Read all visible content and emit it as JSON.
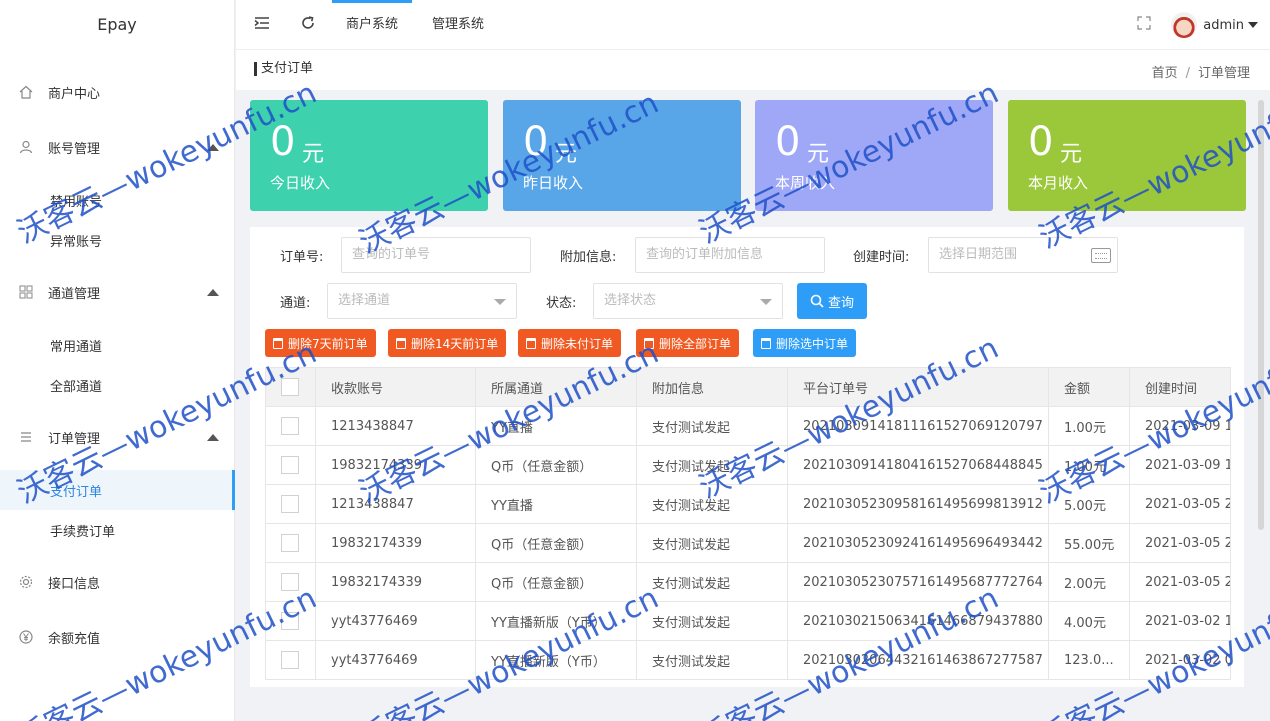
{
  "app": {
    "brand": "Epay"
  },
  "sidebar": {
    "items": [
      {
        "label": "商户中心",
        "icon": "home-icon"
      },
      {
        "label": "账号管理",
        "icon": "user-icon",
        "sub": [
          "禁用账号",
          "异常账号"
        ]
      },
      {
        "label": "通道管理",
        "icon": "apps-icon",
        "sub": [
          "常用通道",
          "全部通道"
        ]
      },
      {
        "label": "订单管理",
        "icon": "list-icon",
        "sub": [
          "支付订单",
          "手续费订单"
        ],
        "active_sub": "支付订单"
      },
      {
        "label": "接口信息",
        "icon": "gear-icon"
      },
      {
        "label": "余额充值",
        "icon": "yen-icon"
      }
    ]
  },
  "header": {
    "tabs": [
      "商户系统",
      "管理系统"
    ],
    "user": "admin"
  },
  "breadcrumb": {
    "title": "支付订单",
    "path": [
      "首页",
      "订单管理"
    ],
    "separator": "/"
  },
  "stats": [
    {
      "value": "0",
      "unit": "元",
      "label": "今日收入",
      "color": "#3ed1ae"
    },
    {
      "value": "0",
      "unit": "元",
      "label": "昨日收入",
      "color": "#58a6e8"
    },
    {
      "value": "0",
      "unit": "元",
      "label": "本周收入",
      "color": "#9fa8f7"
    },
    {
      "value": "0",
      "unit": "元",
      "label": "本月收入",
      "color": "#9ac83a"
    }
  ],
  "filters": {
    "order_no": {
      "label": "订单号:",
      "placeholder": "查询的订单号"
    },
    "extra": {
      "label": "附加信息:",
      "placeholder": "查询的订单附加信息"
    },
    "created": {
      "label": "创建时间:",
      "placeholder": "选择日期范围"
    },
    "channel": {
      "label": "通道:",
      "placeholder": "选择通道"
    },
    "status": {
      "label": "状态:",
      "placeholder": "选择状态"
    },
    "search_label": "查询"
  },
  "actions": {
    "del7": "删除7天前订单",
    "del14": "删除14天前订单",
    "delunpaid": "删除未付订单",
    "delall": "删除全部订单",
    "delsel": "删除选中订单"
  },
  "table": {
    "headers": [
      "收款账号",
      "所属通道",
      "附加信息",
      "平台订单号",
      "金额",
      "创建时间"
    ],
    "rows": [
      [
        "1213438847",
        "YY直播",
        "支付测试发起",
        "20210309141811161527069120797",
        "1.00元",
        "2021-03-09 1"
      ],
      [
        "19832174339",
        "Q币（任意金额）",
        "支付测试发起",
        "20210309141804161527068448845",
        "1.00元",
        "2021-03-09 1"
      ],
      [
        "1213438847",
        "YY直播",
        "支付测试发起",
        "20210305230958161495699813912",
        "5.00元",
        "2021-03-05 2"
      ],
      [
        "19832174339",
        "Q币（任意金额）",
        "支付测试发起",
        "20210305230924161495696493442",
        "55.00元",
        "2021-03-05 2"
      ],
      [
        "19832174339",
        "Q币（任意金额）",
        "支付测试发起",
        "20210305230757161495687772764",
        "2.00元",
        "2021-03-05 2"
      ],
      [
        "yyt43776469",
        "YY直播新版（Y币）",
        "支付测试发起",
        "20210302150634161466879437880",
        "4.00元",
        "2021-03-02 1"
      ],
      [
        "yyt43776469",
        "YY直播新版（Y币）",
        "支付测试发起",
        "20210302064432161463867277587",
        "123.0...",
        "2021-03-02 0"
      ]
    ]
  },
  "watermark": "沃客云—wokeyunfu.cn"
}
